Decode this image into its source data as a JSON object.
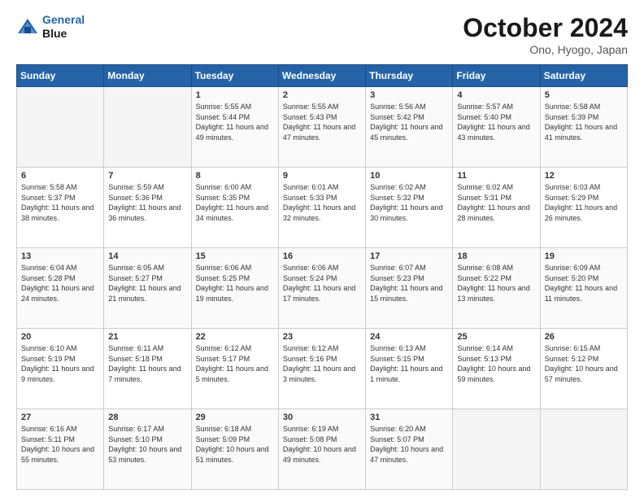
{
  "header": {
    "logo_line1": "General",
    "logo_line2": "Blue",
    "month": "October 2024",
    "location": "Ono, Hyogo, Japan"
  },
  "days_of_week": [
    "Sunday",
    "Monday",
    "Tuesday",
    "Wednesday",
    "Thursday",
    "Friday",
    "Saturday"
  ],
  "weeks": [
    [
      {
        "num": "",
        "info": ""
      },
      {
        "num": "",
        "info": ""
      },
      {
        "num": "1",
        "info": "Sunrise: 5:55 AM\nSunset: 5:44 PM\nDaylight: 11 hours and 49 minutes."
      },
      {
        "num": "2",
        "info": "Sunrise: 5:55 AM\nSunset: 5:43 PM\nDaylight: 11 hours and 47 minutes."
      },
      {
        "num": "3",
        "info": "Sunrise: 5:56 AM\nSunset: 5:42 PM\nDaylight: 11 hours and 45 minutes."
      },
      {
        "num": "4",
        "info": "Sunrise: 5:57 AM\nSunset: 5:40 PM\nDaylight: 11 hours and 43 minutes."
      },
      {
        "num": "5",
        "info": "Sunrise: 5:58 AM\nSunset: 5:39 PM\nDaylight: 11 hours and 41 minutes."
      }
    ],
    [
      {
        "num": "6",
        "info": "Sunrise: 5:58 AM\nSunset: 5:37 PM\nDaylight: 11 hours and 38 minutes."
      },
      {
        "num": "7",
        "info": "Sunrise: 5:59 AM\nSunset: 5:36 PM\nDaylight: 11 hours and 36 minutes."
      },
      {
        "num": "8",
        "info": "Sunrise: 6:00 AM\nSunset: 5:35 PM\nDaylight: 11 hours and 34 minutes."
      },
      {
        "num": "9",
        "info": "Sunrise: 6:01 AM\nSunset: 5:33 PM\nDaylight: 11 hours and 32 minutes."
      },
      {
        "num": "10",
        "info": "Sunrise: 6:02 AM\nSunset: 5:32 PM\nDaylight: 11 hours and 30 minutes."
      },
      {
        "num": "11",
        "info": "Sunrise: 6:02 AM\nSunset: 5:31 PM\nDaylight: 11 hours and 28 minutes."
      },
      {
        "num": "12",
        "info": "Sunrise: 6:03 AM\nSunset: 5:29 PM\nDaylight: 11 hours and 26 minutes."
      }
    ],
    [
      {
        "num": "13",
        "info": "Sunrise: 6:04 AM\nSunset: 5:28 PM\nDaylight: 11 hours and 24 minutes."
      },
      {
        "num": "14",
        "info": "Sunrise: 6:05 AM\nSunset: 5:27 PM\nDaylight: 11 hours and 21 minutes."
      },
      {
        "num": "15",
        "info": "Sunrise: 6:06 AM\nSunset: 5:25 PM\nDaylight: 11 hours and 19 minutes."
      },
      {
        "num": "16",
        "info": "Sunrise: 6:06 AM\nSunset: 5:24 PM\nDaylight: 11 hours and 17 minutes."
      },
      {
        "num": "17",
        "info": "Sunrise: 6:07 AM\nSunset: 5:23 PM\nDaylight: 11 hours and 15 minutes."
      },
      {
        "num": "18",
        "info": "Sunrise: 6:08 AM\nSunset: 5:22 PM\nDaylight: 11 hours and 13 minutes."
      },
      {
        "num": "19",
        "info": "Sunrise: 6:09 AM\nSunset: 5:20 PM\nDaylight: 11 hours and 11 minutes."
      }
    ],
    [
      {
        "num": "20",
        "info": "Sunrise: 6:10 AM\nSunset: 5:19 PM\nDaylight: 11 hours and 9 minutes."
      },
      {
        "num": "21",
        "info": "Sunrise: 6:11 AM\nSunset: 5:18 PM\nDaylight: 11 hours and 7 minutes."
      },
      {
        "num": "22",
        "info": "Sunrise: 6:12 AM\nSunset: 5:17 PM\nDaylight: 11 hours and 5 minutes."
      },
      {
        "num": "23",
        "info": "Sunrise: 6:12 AM\nSunset: 5:16 PM\nDaylight: 11 hours and 3 minutes."
      },
      {
        "num": "24",
        "info": "Sunrise: 6:13 AM\nSunset: 5:15 PM\nDaylight: 11 hours and 1 minute."
      },
      {
        "num": "25",
        "info": "Sunrise: 6:14 AM\nSunset: 5:13 PM\nDaylight: 10 hours and 59 minutes."
      },
      {
        "num": "26",
        "info": "Sunrise: 6:15 AM\nSunset: 5:12 PM\nDaylight: 10 hours and 57 minutes."
      }
    ],
    [
      {
        "num": "27",
        "info": "Sunrise: 6:16 AM\nSunset: 5:11 PM\nDaylight: 10 hours and 55 minutes."
      },
      {
        "num": "28",
        "info": "Sunrise: 6:17 AM\nSunset: 5:10 PM\nDaylight: 10 hours and 53 minutes."
      },
      {
        "num": "29",
        "info": "Sunrise: 6:18 AM\nSunset: 5:09 PM\nDaylight: 10 hours and 51 minutes."
      },
      {
        "num": "30",
        "info": "Sunrise: 6:19 AM\nSunset: 5:08 PM\nDaylight: 10 hours and 49 minutes."
      },
      {
        "num": "31",
        "info": "Sunrise: 6:20 AM\nSunset: 5:07 PM\nDaylight: 10 hours and 47 minutes."
      },
      {
        "num": "",
        "info": ""
      },
      {
        "num": "",
        "info": ""
      }
    ]
  ]
}
